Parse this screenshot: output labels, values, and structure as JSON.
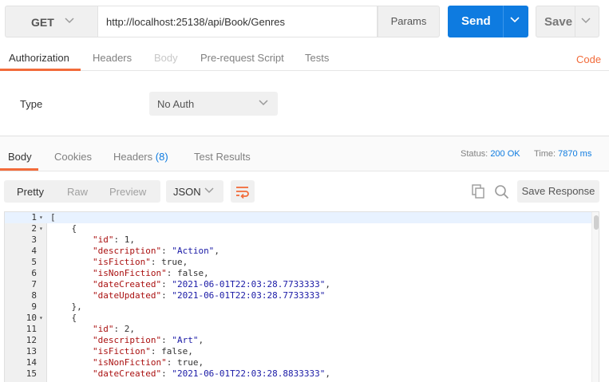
{
  "request": {
    "method": "GET",
    "url": "http://localhost:25138/api/Book/Genres",
    "params_label": "Params",
    "send_label": "Send",
    "save_label": "Save"
  },
  "request_tabs": [
    {
      "label": "Authorization"
    },
    {
      "label": "Headers"
    },
    {
      "label": "Body"
    },
    {
      "label": "Pre-request Script"
    },
    {
      "label": "Tests"
    }
  ],
  "code_link": "Code",
  "auth": {
    "type_label": "Type",
    "type_value": "No Auth"
  },
  "response_tabs": [
    {
      "label": "Body"
    },
    {
      "label": "Cookies"
    },
    {
      "label": "Headers",
      "count": "(8)"
    },
    {
      "label": "Test Results"
    }
  ],
  "response_status": {
    "status_label": "Status:",
    "status_value": "200 OK",
    "time_label": "Time:",
    "time_value": "7870 ms"
  },
  "toolbar": {
    "formats": [
      "Pretty",
      "Raw",
      "Preview"
    ],
    "language": "JSON",
    "save_response_label": "Save Response"
  },
  "colors": {
    "accent": "#f26b3a",
    "primary": "#0e7be0"
  },
  "code_lines": [
    {
      "n": "1",
      "fold": true,
      "parts": [
        [
          "p",
          "["
        ]
      ]
    },
    {
      "n": "2",
      "fold": true,
      "parts": [
        [
          "p",
          "    {"
        ]
      ]
    },
    {
      "n": "3",
      "parts": [
        [
          "p",
          "        "
        ],
        [
          "k",
          "\"id\""
        ],
        [
          "p",
          ": 1,"
        ]
      ]
    },
    {
      "n": "4",
      "parts": [
        [
          "p",
          "        "
        ],
        [
          "k",
          "\"description\""
        ],
        [
          "p",
          ": "
        ],
        [
          "s",
          "\"Action\""
        ],
        [
          "p",
          ","
        ]
      ]
    },
    {
      "n": "5",
      "parts": [
        [
          "p",
          "        "
        ],
        [
          "k",
          "\"isFiction\""
        ],
        [
          "p",
          ": true,"
        ]
      ]
    },
    {
      "n": "6",
      "parts": [
        [
          "p",
          "        "
        ],
        [
          "k",
          "\"isNonFiction\""
        ],
        [
          "p",
          ": false,"
        ]
      ]
    },
    {
      "n": "7",
      "parts": [
        [
          "p",
          "        "
        ],
        [
          "k",
          "\"dateCreated\""
        ],
        [
          "p",
          ": "
        ],
        [
          "s",
          "\"2021-06-01T22:03:28.7733333\""
        ],
        [
          "p",
          ","
        ]
      ]
    },
    {
      "n": "8",
      "parts": [
        [
          "p",
          "        "
        ],
        [
          "k",
          "\"dateUpdated\""
        ],
        [
          "p",
          ": "
        ],
        [
          "s",
          "\"2021-06-01T22:03:28.7733333\""
        ]
      ]
    },
    {
      "n": "9",
      "parts": [
        [
          "p",
          "    },"
        ]
      ]
    },
    {
      "n": "10",
      "fold": true,
      "parts": [
        [
          "p",
          "    {"
        ]
      ]
    },
    {
      "n": "11",
      "parts": [
        [
          "p",
          "        "
        ],
        [
          "k",
          "\"id\""
        ],
        [
          "p",
          ": 2,"
        ]
      ]
    },
    {
      "n": "12",
      "parts": [
        [
          "p",
          "        "
        ],
        [
          "k",
          "\"description\""
        ],
        [
          "p",
          ": "
        ],
        [
          "s",
          "\"Art\""
        ],
        [
          "p",
          ","
        ]
      ]
    },
    {
      "n": "13",
      "parts": [
        [
          "p",
          "        "
        ],
        [
          "k",
          "\"isFiction\""
        ],
        [
          "p",
          ": false,"
        ]
      ]
    },
    {
      "n": "14",
      "parts": [
        [
          "p",
          "        "
        ],
        [
          "k",
          "\"isNonFiction\""
        ],
        [
          "p",
          ": true,"
        ]
      ]
    },
    {
      "n": "15",
      "parts": [
        [
          "p",
          "        "
        ],
        [
          "k",
          "\"dateCreated\""
        ],
        [
          "p",
          ": "
        ],
        [
          "s",
          "\"2021-06-01T22:03:28.8833333\""
        ],
        [
          "p",
          ","
        ]
      ]
    }
  ]
}
